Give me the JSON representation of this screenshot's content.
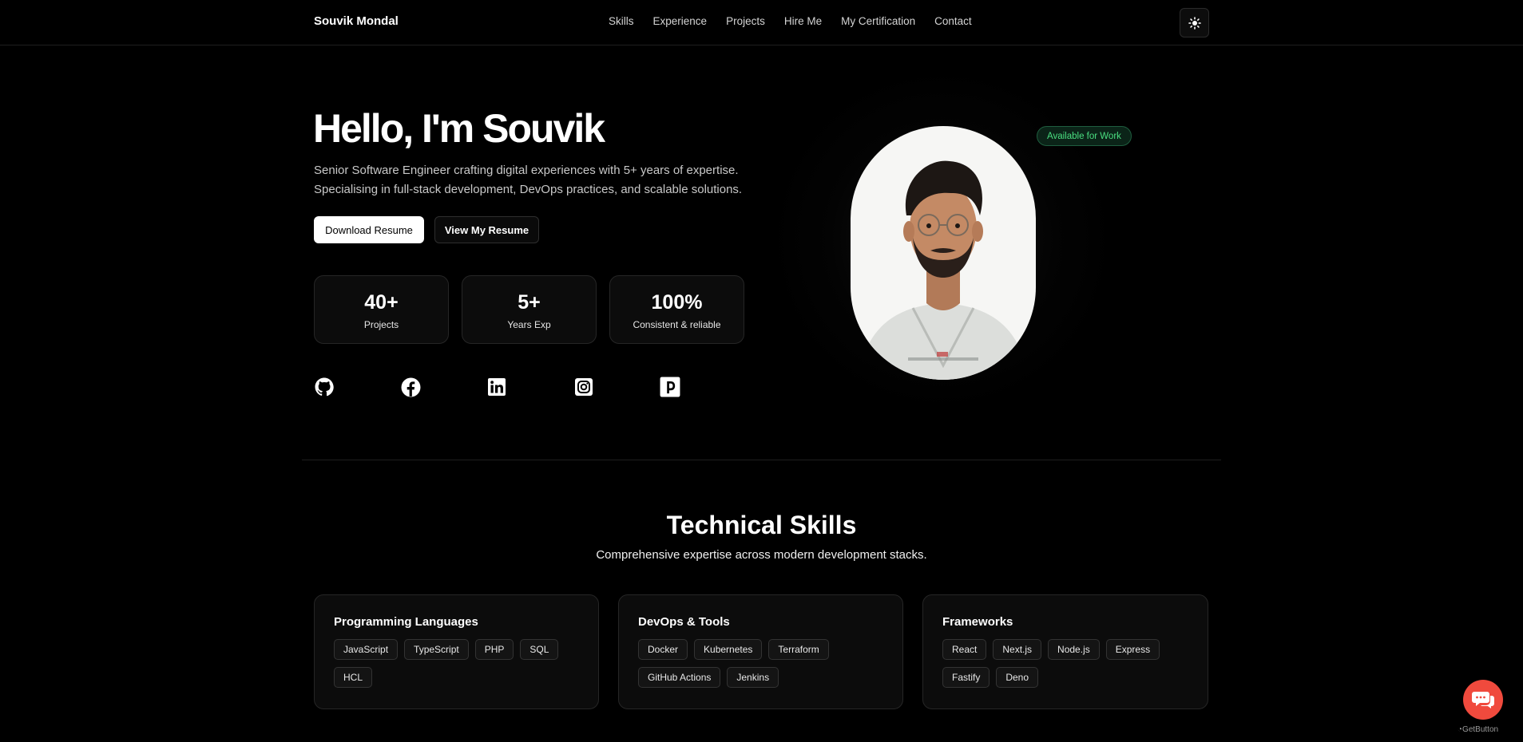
{
  "header": {
    "brand": "Souvik Mondal",
    "nav": [
      "Skills",
      "Experience",
      "Projects",
      "Hire Me",
      "My Certification",
      "Contact"
    ],
    "theme_toggle_icon": "sun-icon"
  },
  "hero": {
    "title": "Hello, I'm Souvik",
    "subtitle_line1": "Senior Software Engineer crafting digital experiences with 5+ years of expertise.",
    "subtitle_line2": "Specialising in full-stack development, DevOps practices, and scalable solutions.",
    "download_label": "Download Resume",
    "view_label": "View My Resume",
    "badge": "Available for Work",
    "stats": [
      {
        "value": "40+",
        "label": "Projects"
      },
      {
        "value": "5+",
        "label": "Years Exp"
      },
      {
        "value": "100%",
        "label": "Consistent & reliable"
      }
    ],
    "socials": [
      "github-icon",
      "facebook-icon",
      "linkedin-icon",
      "instagram-icon",
      "dev-icon"
    ]
  },
  "skills": {
    "title": "Technical Skills",
    "subtitle": "Comprehensive expertise across modern development stacks.",
    "categories": [
      {
        "title": "Programming Languages",
        "items": [
          "JavaScript",
          "TypeScript",
          "PHP",
          "SQL",
          "HCL"
        ]
      },
      {
        "title": "DevOps & Tools",
        "items": [
          "Docker",
          "Kubernetes",
          "Terraform",
          "GitHub Actions",
          "Jenkins"
        ]
      },
      {
        "title": "Frameworks",
        "items": [
          "React",
          "Next.js",
          "Node.js",
          "Express",
          "Fastify",
          "Deno"
        ]
      }
    ]
  },
  "widget": {
    "chat_icon": "chat-bubbles-icon",
    "credit": "GetButton"
  },
  "colors": {
    "background": "#000000",
    "badge_text": "#4ade80",
    "chat_button": "#f04a3d"
  }
}
